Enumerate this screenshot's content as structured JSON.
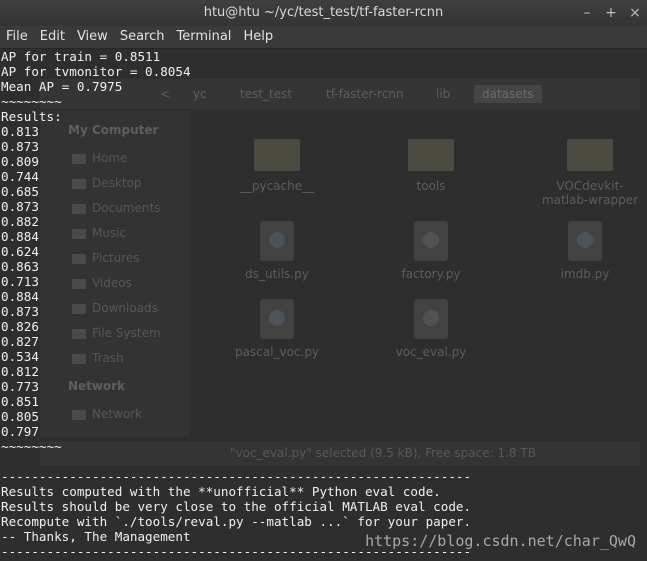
{
  "window": {
    "title": "htu@htu ~/yc/test_test/tf-faster-rcnn",
    "controls": {
      "minimize": "–",
      "maximize": "+",
      "close": "×"
    }
  },
  "menu": [
    "File",
    "Edit",
    "View",
    "Search",
    "Terminal",
    "Help"
  ],
  "background_file_manager": {
    "breadcrumbs": [
      "<",
      "yc",
      "test_test",
      "tf-faster-rcnn",
      "lib",
      "datasets"
    ],
    "sidebar": {
      "heading_computer": "My Computer",
      "items": [
        "Home",
        "Desktop",
        "Documents",
        "Music",
        "Pictures",
        "Videos",
        "Downloads",
        "File System",
        "Trash"
      ],
      "heading_network": "Network",
      "network_items": [
        "Network"
      ]
    },
    "files": [
      {
        "name": "__pycache__",
        "kind": "folder"
      },
      {
        "name": "tools",
        "kind": "folder"
      },
      {
        "name": "VOCdevkit-matlab-wrapper",
        "kind": "folder"
      },
      {
        "name": "ds_utils.py",
        "kind": "python"
      },
      {
        "name": "factory.py",
        "kind": "python"
      },
      {
        "name": "imdb.py",
        "kind": "python"
      },
      {
        "name": "pascal_voc.py",
        "kind": "python"
      },
      {
        "name": "voc_eval.py",
        "kind": "python"
      }
    ],
    "status": "\"voc_eval.py\" selected (9.5 kB), Free space: 1.8 TB"
  },
  "terminal_lines": [
    "AP for train = 0.8511",
    "AP for tvmonitor = 0.8054",
    "Mean AP = 0.7975",
    "~~~~~~~~",
    "Results:",
    "0.813",
    "0.873",
    "0.809",
    "0.744",
    "0.685",
    "0.873",
    "0.882",
    "0.884",
    "0.624",
    "0.863",
    "0.713",
    "0.884",
    "0.873",
    "0.826",
    "0.827",
    "0.534",
    "0.812",
    "0.773",
    "0.851",
    "0.805",
    "0.797",
    "~~~~~~~~",
    "",
    "--------------------------------------------------------------",
    "Results computed with the **unofficial** Python eval code.",
    "Results should be very close to the official MATLAB eval code.",
    "Recompute with `./tools/reval.py --matlab ...` for your paper.",
    "-- Thanks, The Management",
    "--------------------------------------------------------------"
  ],
  "watermark": "https://blog.csdn.net/char_QwQ"
}
